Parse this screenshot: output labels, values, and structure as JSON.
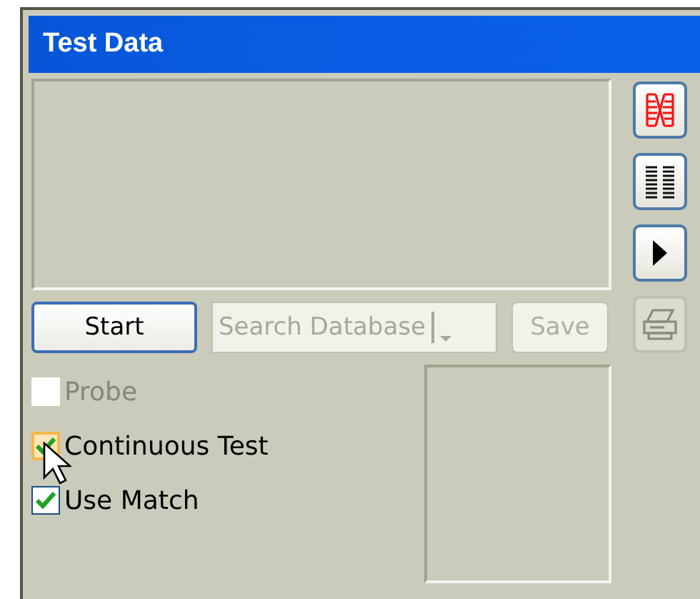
{
  "window": {
    "title": "Test Data"
  },
  "side_buttons": [
    {
      "kind": "match",
      "disabled": false
    },
    {
      "kind": "columns",
      "disabled": false
    },
    {
      "kind": "play",
      "disabled": false
    },
    {
      "kind": "print",
      "disabled": true
    }
  ],
  "controls": [
    {
      "kind": "button",
      "label": "Start",
      "disabled": false,
      "focused": true
    },
    {
      "kind": "combo",
      "value": "Search Database",
      "disabled": true,
      "focused": false
    },
    {
      "kind": "button",
      "label": "Save",
      "disabled": true,
      "focused": false
    }
  ],
  "checkboxes": [
    {
      "label": "Probe",
      "checked": false,
      "disabled": true,
      "hovered": false
    },
    {
      "label": "Continuous Test",
      "checked": true,
      "disabled": false,
      "hovered": true
    },
    {
      "label": "Use Match",
      "checked": true,
      "disabled": false,
      "hovered": false
    }
  ]
}
